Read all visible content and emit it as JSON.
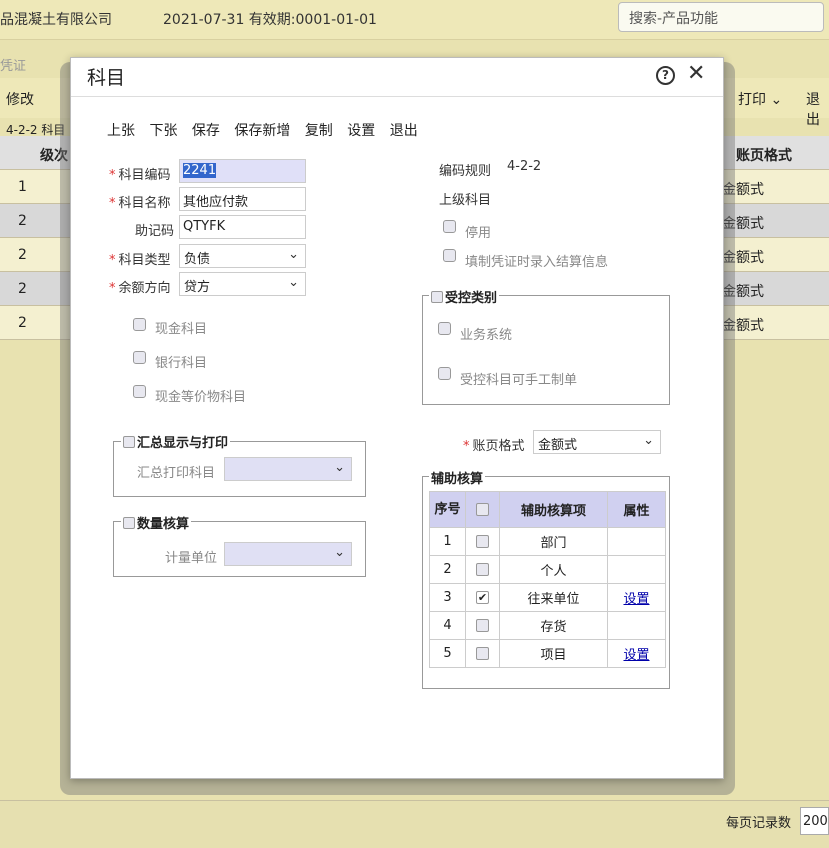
{
  "app": {
    "company": "品混凝土有限公司",
    "date_line": "2021-07-31  有效期:0001-01-01",
    "search_placeholder": "搜索-产品功能",
    "voucher_tab": "凭证",
    "edit_label": "修改",
    "print_label": "打印",
    "exit_label": "退出",
    "rule_label": "4-2-2  科目",
    "grid_headers": {
      "level": "级次",
      "ledger_format": "账页格式"
    },
    "grid_rows": [
      {
        "level": "1",
        "format": "金额式"
      },
      {
        "level": "2",
        "format": "金额式"
      },
      {
        "level": "2",
        "format": "金额式"
      },
      {
        "level": "2",
        "format": "金额式"
      },
      {
        "level": "2",
        "format": "金额式"
      }
    ],
    "per_page_label": "每页记录数",
    "per_page_value": "200"
  },
  "modal": {
    "title": "科目",
    "toolbar": [
      "上张",
      "下张",
      "保存",
      "保存新增",
      "复制",
      "设置",
      "退出"
    ],
    "fields": {
      "code_label": "科目编码",
      "code_value": "2241",
      "name_label": "科目名称",
      "name_value": "其他应付款",
      "mnemonic_label": "助记码",
      "mnemonic_value": "QTYFK",
      "type_label": "科目类型",
      "type_value": "负债",
      "direction_label": "余额方向",
      "direction_value": "贷方"
    },
    "left_checks": [
      "现金科目",
      "银行科目",
      "现金等价物科目"
    ],
    "summary_group": {
      "title": "汇总显示与打印",
      "field_label": "汇总打印科目"
    },
    "quantity_group": {
      "title": "数量核算",
      "field_label": "计量单位"
    },
    "right": {
      "code_rule_label": "编码规则",
      "code_rule_value": "4-2-2",
      "parent_label": "上级科目",
      "disable_label": "停用",
      "settlement_label": "填制凭证时录入结算信息"
    },
    "controlled_group": {
      "title": "受控类别",
      "items": [
        "业务系统",
        "受控科目可手工制单"
      ]
    },
    "ledger_format": {
      "label": "账页格式",
      "value": "金额式"
    },
    "aux_group": {
      "title": "辅助核算",
      "headers": {
        "no": "序号",
        "item": "辅助核算项",
        "attr": "属性"
      },
      "rows": [
        {
          "no": "1",
          "checked": false,
          "item": "部门",
          "attr": ""
        },
        {
          "no": "2",
          "checked": false,
          "item": "个人",
          "attr": ""
        },
        {
          "no": "3",
          "checked": true,
          "item": "往来单位",
          "attr": "设置"
        },
        {
          "no": "4",
          "checked": false,
          "item": "存货",
          "attr": ""
        },
        {
          "no": "5",
          "checked": false,
          "item": "项目",
          "attr": "设置"
        }
      ]
    }
  }
}
